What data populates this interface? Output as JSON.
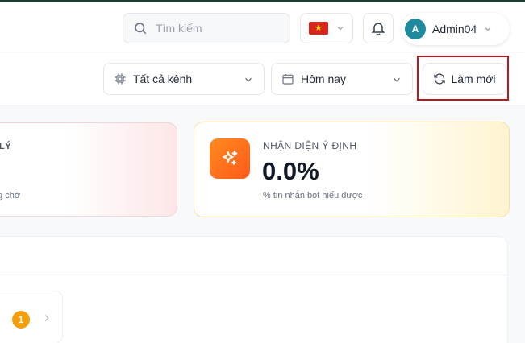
{
  "header": {
    "search": {
      "placeholder": "Tìm kiếm"
    },
    "language": {
      "flag": "vietnam-flag",
      "flag_colors": [
        "#da251d",
        "#ffdd00"
      ]
    },
    "user": {
      "initial": "A",
      "name": "Admin04",
      "avatar_color": "#1f8a9e"
    }
  },
  "toolbar": {
    "channel_filter": {
      "value": "Tất cả kênh"
    },
    "date_filter": {
      "value": "Hôm nay"
    },
    "refresh_label": "Làm mới",
    "highlight_color": "#c0161f"
  },
  "cards": {
    "left_partial": {
      "title": "LÝ",
      "subtitle": "ng chờ"
    },
    "intent": {
      "title": "NHẬN DIỆN Ý ĐỊNH",
      "value": "0.0%",
      "subtitle": "% tin nhắn bot hiểu được",
      "icon": "sparkles-icon",
      "accent": "#ff7a1a"
    }
  },
  "pagination": {
    "current_page": "1",
    "badge_color": "#f59e0b"
  }
}
